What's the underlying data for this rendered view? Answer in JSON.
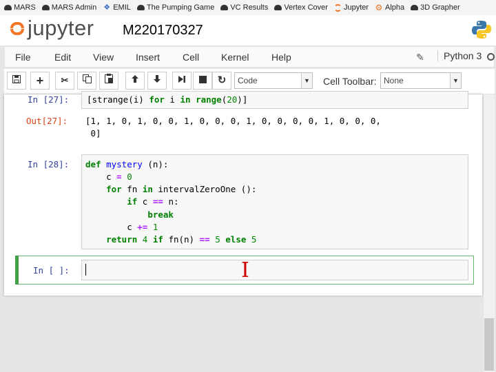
{
  "bookmarks": [
    {
      "label": "MARS",
      "icon": "mars-icon"
    },
    {
      "label": "MARS Admin",
      "icon": "mars-icon"
    },
    {
      "label": "EMIL",
      "icon": "globe-icon"
    },
    {
      "label": "The Pumping Game",
      "icon": "mars-icon"
    },
    {
      "label": "VC Results",
      "icon": "mars-icon"
    },
    {
      "label": "Vertex Cover",
      "icon": "mars-icon"
    },
    {
      "label": "Jupyter",
      "icon": "jupyter-icon"
    },
    {
      "label": "Alpha",
      "icon": "gear-icon"
    },
    {
      "label": "3D Grapher",
      "icon": "mars-icon"
    }
  ],
  "header": {
    "logo_text": "jupyter",
    "notebook_name": "M220170327"
  },
  "menu": [
    "File",
    "Edit",
    "View",
    "Insert",
    "Cell",
    "Kernel",
    "Help"
  ],
  "kernel": {
    "name": "Python 3"
  },
  "toolbar": {
    "buttons": [
      "save-icon",
      "plus-icon",
      "scissors-icon",
      "copy-icon",
      "paste-icon",
      "arrow-up-icon",
      "arrow-down-icon",
      "step-forward-icon",
      "stop-icon",
      "refresh-icon"
    ],
    "cell_type": "Code",
    "cell_toolbar_label": "Cell Toolbar:",
    "cell_toolbar_value": "None"
  },
  "cells": {
    "c27": {
      "prompt_in": "In [27]:",
      "code": "[strange(i) for i in range(20)]",
      "prompt_out": "Out[27]:",
      "output_line1": "[1, 1, 0, 1, 0, 0, 1, 0, 0, 0, 1, 0, 0, 0, 0, 1, 0, 0, 0,",
      "output_line2": " 0]"
    },
    "c28": {
      "prompt_in": "In [28]:",
      "lines": [
        "def mystery (n):",
        "    c = 0",
        "    for fn in intervalZeroOne ():",
        "        if c == n:",
        "            break",
        "        c += 1",
        "    return 4 if fn(n) == 5 else 5"
      ]
    },
    "c_new": {
      "prompt_in": "In [ ]:"
    }
  },
  "colors": {
    "accent": "#f37726",
    "prompt_in": "#303f9f",
    "prompt_out": "#d84315",
    "keyword": "#008000",
    "selected_border": "#66bb6a"
  }
}
